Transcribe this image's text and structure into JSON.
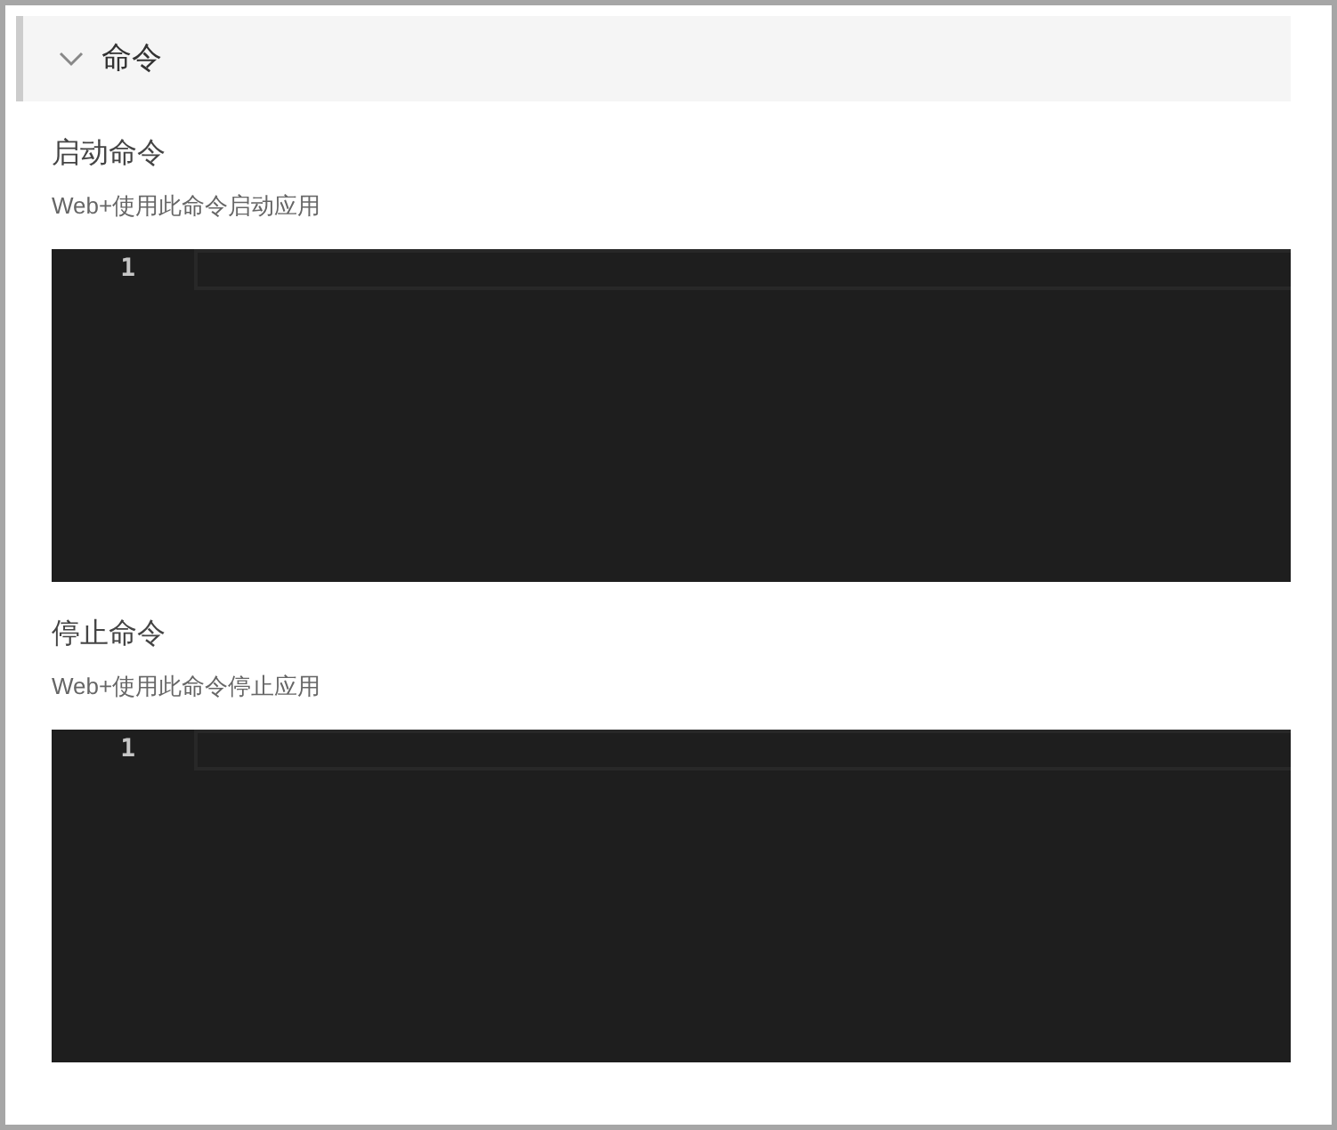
{
  "panel": {
    "title": "命令",
    "expanded": true
  },
  "sections": [
    {
      "label": "启动命令",
      "description": "Web+使用此命令启动应用",
      "editor": {
        "line_numbers": [
          "1"
        ]
      }
    },
    {
      "label": "停止命令",
      "description": "Web+使用此命令停止应用",
      "editor": {
        "line_numbers": [
          "1"
        ]
      }
    }
  ]
}
